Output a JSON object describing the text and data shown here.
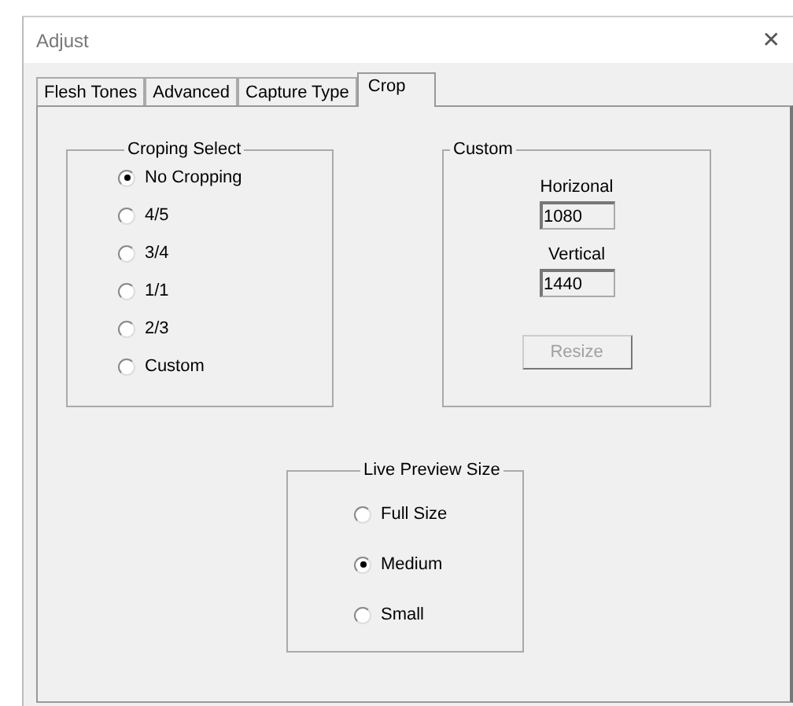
{
  "window": {
    "title": "Adjust",
    "close": "✕"
  },
  "tabs": [
    {
      "label": "Flesh Tones",
      "selected": false
    },
    {
      "label": "Advanced",
      "selected": false
    },
    {
      "label": "Capture Type",
      "selected": false
    },
    {
      "label": "Crop",
      "selected": true
    }
  ],
  "cropping_select": {
    "title": "Croping Select",
    "options": [
      {
        "label": "No Cropping",
        "selected": true
      },
      {
        "label": "4/5",
        "selected": false
      },
      {
        "label": "3/4",
        "selected": false
      },
      {
        "label": "1/1",
        "selected": false
      },
      {
        "label": "2/3",
        "selected": false
      },
      {
        "label": "Custom",
        "selected": false
      }
    ]
  },
  "custom": {
    "title": "Custom",
    "fields": [
      {
        "label": "Horizonal",
        "value": "1080"
      },
      {
        "label": "Vertical",
        "value": "1440"
      }
    ],
    "button": {
      "label": "Resize",
      "disabled": true
    }
  },
  "live_preview_size": {
    "title": "Live Preview Size",
    "options": [
      {
        "label": "Full Size",
        "selected": false
      },
      {
        "label": "Medium",
        "selected": true
      },
      {
        "label": "Small",
        "selected": false
      }
    ]
  }
}
